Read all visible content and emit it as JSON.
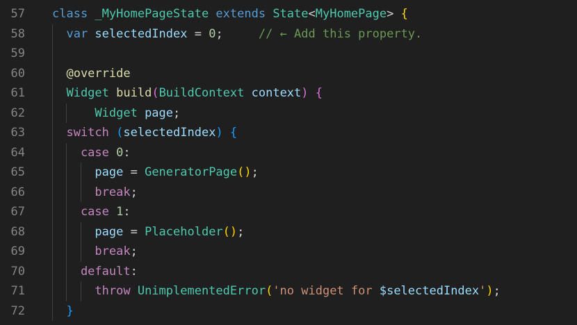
{
  "editor": {
    "colors": {
      "background": "#1f1f1f",
      "line_number": "#858585",
      "keyword": "#569cd6",
      "control_keyword": "#c586c0",
      "type": "#4ec9b0",
      "identifier": "#9cdcfe",
      "function": "#dcdcaa",
      "number": "#b5cea8",
      "string": "#ce9178",
      "comment": "#6a9955",
      "bracket_1": "#ffd700",
      "bracket_2": "#da70d6",
      "bracket_3": "#179fff"
    },
    "lines": [
      {
        "number": "57",
        "tokens": [
          {
            "t": "class ",
            "c": "kw"
          },
          {
            "t": "_MyHomePageState ",
            "c": "type"
          },
          {
            "t": "extends ",
            "c": "kw"
          },
          {
            "t": "State",
            "c": "type"
          },
          {
            "t": "<",
            "c": "pun"
          },
          {
            "t": "MyHomePage",
            "c": "type"
          },
          {
            "t": "> ",
            "c": "pun"
          },
          {
            "t": "{",
            "c": "b1"
          }
        ]
      },
      {
        "number": "58",
        "tokens": [
          {
            "t": "  var ",
            "c": "kw"
          },
          {
            "t": "selectedIndex ",
            "c": "var"
          },
          {
            "t": "= ",
            "c": "pun"
          },
          {
            "t": "0",
            "c": "num"
          },
          {
            "t": ";     ",
            "c": "pun"
          },
          {
            "t": "// ← Add this property.",
            "c": "cmt"
          }
        ]
      },
      {
        "number": "59",
        "tokens": []
      },
      {
        "number": "60",
        "tokens": [
          {
            "t": "  @override",
            "c": "ann"
          }
        ]
      },
      {
        "number": "61",
        "tokens": [
          {
            "t": "  Widget ",
            "c": "type"
          },
          {
            "t": "build",
            "c": "fn"
          },
          {
            "t": "(",
            "c": "b2"
          },
          {
            "t": "BuildContext ",
            "c": "type"
          },
          {
            "t": "context",
            "c": "var"
          },
          {
            "t": ") ",
            "c": "b2"
          },
          {
            "t": "{",
            "c": "b2"
          }
        ]
      },
      {
        "number": "62",
        "tokens": [
          {
            "t": "      Widget ",
            "c": "type"
          },
          {
            "t": "page",
            "c": "var"
          },
          {
            "t": ";",
            "c": "pun"
          }
        ]
      },
      {
        "number": "63",
        "tokens": [
          {
            "t": "  switch ",
            "c": "kw2"
          },
          {
            "t": "(",
            "c": "b3"
          },
          {
            "t": "selectedIndex",
            "c": "var"
          },
          {
            "t": ") ",
            "c": "b3"
          },
          {
            "t": "{",
            "c": "b3"
          }
        ]
      },
      {
        "number": "64",
        "tokens": [
          {
            "t": "    case ",
            "c": "kw2"
          },
          {
            "t": "0",
            "c": "num"
          },
          {
            "t": ":",
            "c": "pun"
          }
        ]
      },
      {
        "number": "65",
        "tokens": [
          {
            "t": "      page ",
            "c": "var"
          },
          {
            "t": "= ",
            "c": "pun"
          },
          {
            "t": "GeneratorPage",
            "c": "type"
          },
          {
            "t": "()",
            "c": "b1"
          },
          {
            "t": ";",
            "c": "pun"
          }
        ]
      },
      {
        "number": "66",
        "tokens": [
          {
            "t": "      break",
            "c": "kw2"
          },
          {
            "t": ";",
            "c": "pun"
          }
        ]
      },
      {
        "number": "67",
        "tokens": [
          {
            "t": "    case ",
            "c": "kw2"
          },
          {
            "t": "1",
            "c": "num"
          },
          {
            "t": ":",
            "c": "pun"
          }
        ]
      },
      {
        "number": "68",
        "tokens": [
          {
            "t": "      page ",
            "c": "var"
          },
          {
            "t": "= ",
            "c": "pun"
          },
          {
            "t": "Placeholder",
            "c": "type"
          },
          {
            "t": "()",
            "c": "b1"
          },
          {
            "t": ";",
            "c": "pun"
          }
        ]
      },
      {
        "number": "69",
        "tokens": [
          {
            "t": "      break",
            "c": "kw2"
          },
          {
            "t": ";",
            "c": "pun"
          }
        ]
      },
      {
        "number": "70",
        "tokens": [
          {
            "t": "    default",
            "c": "kw2"
          },
          {
            "t": ":",
            "c": "pun"
          }
        ]
      },
      {
        "number": "71",
        "tokens": [
          {
            "t": "      throw ",
            "c": "kw2"
          },
          {
            "t": "UnimplementedError",
            "c": "type"
          },
          {
            "t": "(",
            "c": "b1"
          },
          {
            "t": "'no widget for ",
            "c": "str"
          },
          {
            "t": "$selectedIndex",
            "c": "var"
          },
          {
            "t": "'",
            "c": "str"
          },
          {
            "t": ")",
            "c": "b1"
          },
          {
            "t": ";",
            "c": "pun"
          }
        ]
      },
      {
        "number": "72",
        "tokens": [
          {
            "t": "  }",
            "c": "b3"
          }
        ]
      }
    ]
  }
}
